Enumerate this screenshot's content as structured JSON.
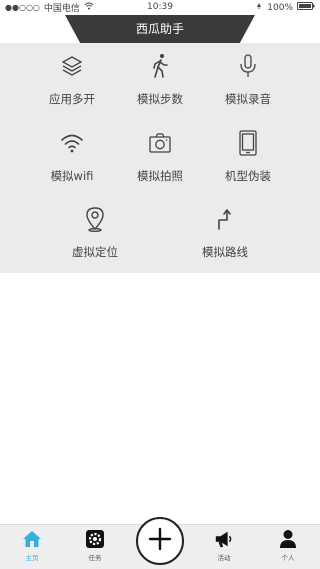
{
  "status_bar": {
    "carrier": "中国电信",
    "time": "10:39",
    "battery": "100%"
  },
  "header": {
    "title": "西瓜助手"
  },
  "grid": {
    "items": [
      {
        "label": "应用多开",
        "icon": "layers-icon"
      },
      {
        "label": "模拟步数",
        "icon": "walking-icon"
      },
      {
        "label": "模拟录音",
        "icon": "microphone-icon"
      },
      {
        "label": "模拟wifi",
        "icon": "wifi-icon"
      },
      {
        "label": "模拟拍照",
        "icon": "camera-icon"
      },
      {
        "label": "机型伪装",
        "icon": "phone-icon"
      },
      {
        "label": "虚拟定位",
        "icon": "location-pin-icon"
      },
      {
        "label": "模拟路线",
        "icon": "route-arrow-icon"
      }
    ]
  },
  "bottom_nav": {
    "items": [
      {
        "label": "主页",
        "icon": "home-icon",
        "active": true
      },
      {
        "label": "任务",
        "icon": "gear-icon",
        "active": false
      },
      {
        "label": "活动",
        "icon": "megaphone-icon",
        "active": false
      },
      {
        "label": "个人",
        "icon": "person-icon",
        "active": false
      }
    ],
    "add_button_icon": "plus-icon"
  },
  "colors": {
    "title_bar": "#3a3a3a",
    "panel": "#ebebec",
    "accent": "#3aaee0",
    "nav_bg": "#eeeeef"
  }
}
